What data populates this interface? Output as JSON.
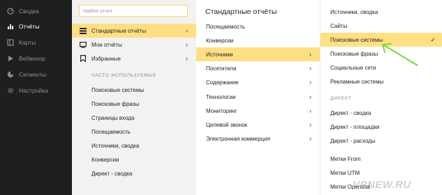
{
  "sidebar": {
    "items": [
      {
        "label": "Сводка",
        "icon": "dashboard-icon"
      },
      {
        "label": "Отчёты",
        "icon": "bar-chart-icon",
        "active": true
      },
      {
        "label": "Карты",
        "icon": "map-icon"
      },
      {
        "label": "Вебвизор",
        "icon": "play-icon"
      },
      {
        "label": "Сегменты",
        "icon": "pie-icon"
      },
      {
        "label": "Настройка",
        "icon": "gear-icon"
      }
    ]
  },
  "col1": {
    "search_placeholder": "Найти отчет",
    "menu": [
      {
        "label": "Стандартные отчёты",
        "icon": "stack-icon",
        "selected": true
      },
      {
        "label": "Мои отчёты",
        "icon": "monitor-icon"
      },
      {
        "label": "Избранные",
        "icon": "bookmark-icon"
      }
    ],
    "frequent_title": "ЧАСТО ИСПОЛЬЗУЕМЫЕ",
    "frequent": [
      "Поисковые системы",
      "Поисковые фразы",
      "Страницы входа",
      "Посещаемость",
      "Источники, сводка",
      "Конверсии",
      "Директ - сводка"
    ]
  },
  "col2": {
    "title": "Стандартные отчёты",
    "items": [
      {
        "label": "Посещаемость",
        "chevron": false
      },
      {
        "label": "Конверсии",
        "chevron": false
      },
      {
        "label": "Источники",
        "chevron": true,
        "selected": true
      },
      {
        "label": "Посетители",
        "chevron": true
      },
      {
        "label": "Содержание",
        "chevron": true
      },
      {
        "label": "Технологии",
        "chevron": true
      },
      {
        "label": "Мониторинг",
        "chevron": true
      },
      {
        "label": "Целевой звонок",
        "chevron": true
      },
      {
        "label": "Электронная коммерция",
        "chevron": true
      }
    ]
  },
  "col3": {
    "items": [
      {
        "label": "Источники, сводка"
      },
      {
        "label": "Сайты"
      },
      {
        "label": "Поисковые системы",
        "selected": true,
        "checked": true
      },
      {
        "label": "Поисковые фразы"
      },
      {
        "label": "Социальные сети"
      },
      {
        "label": "Рекламные системы"
      }
    ],
    "section_title": "ДИРЕКТ",
    "section_items": [
      "Директ - сводка",
      "Директ - площадки",
      "Директ - расходы",
      "Метки From",
      "Метки UTM",
      "Метки Openstat"
    ]
  },
  "colors": {
    "sidebar_bg": "#1e1f21",
    "highlight": "#ffdf84",
    "arrow": "#7cd93c"
  },
  "watermark": "VPNEW.RU"
}
